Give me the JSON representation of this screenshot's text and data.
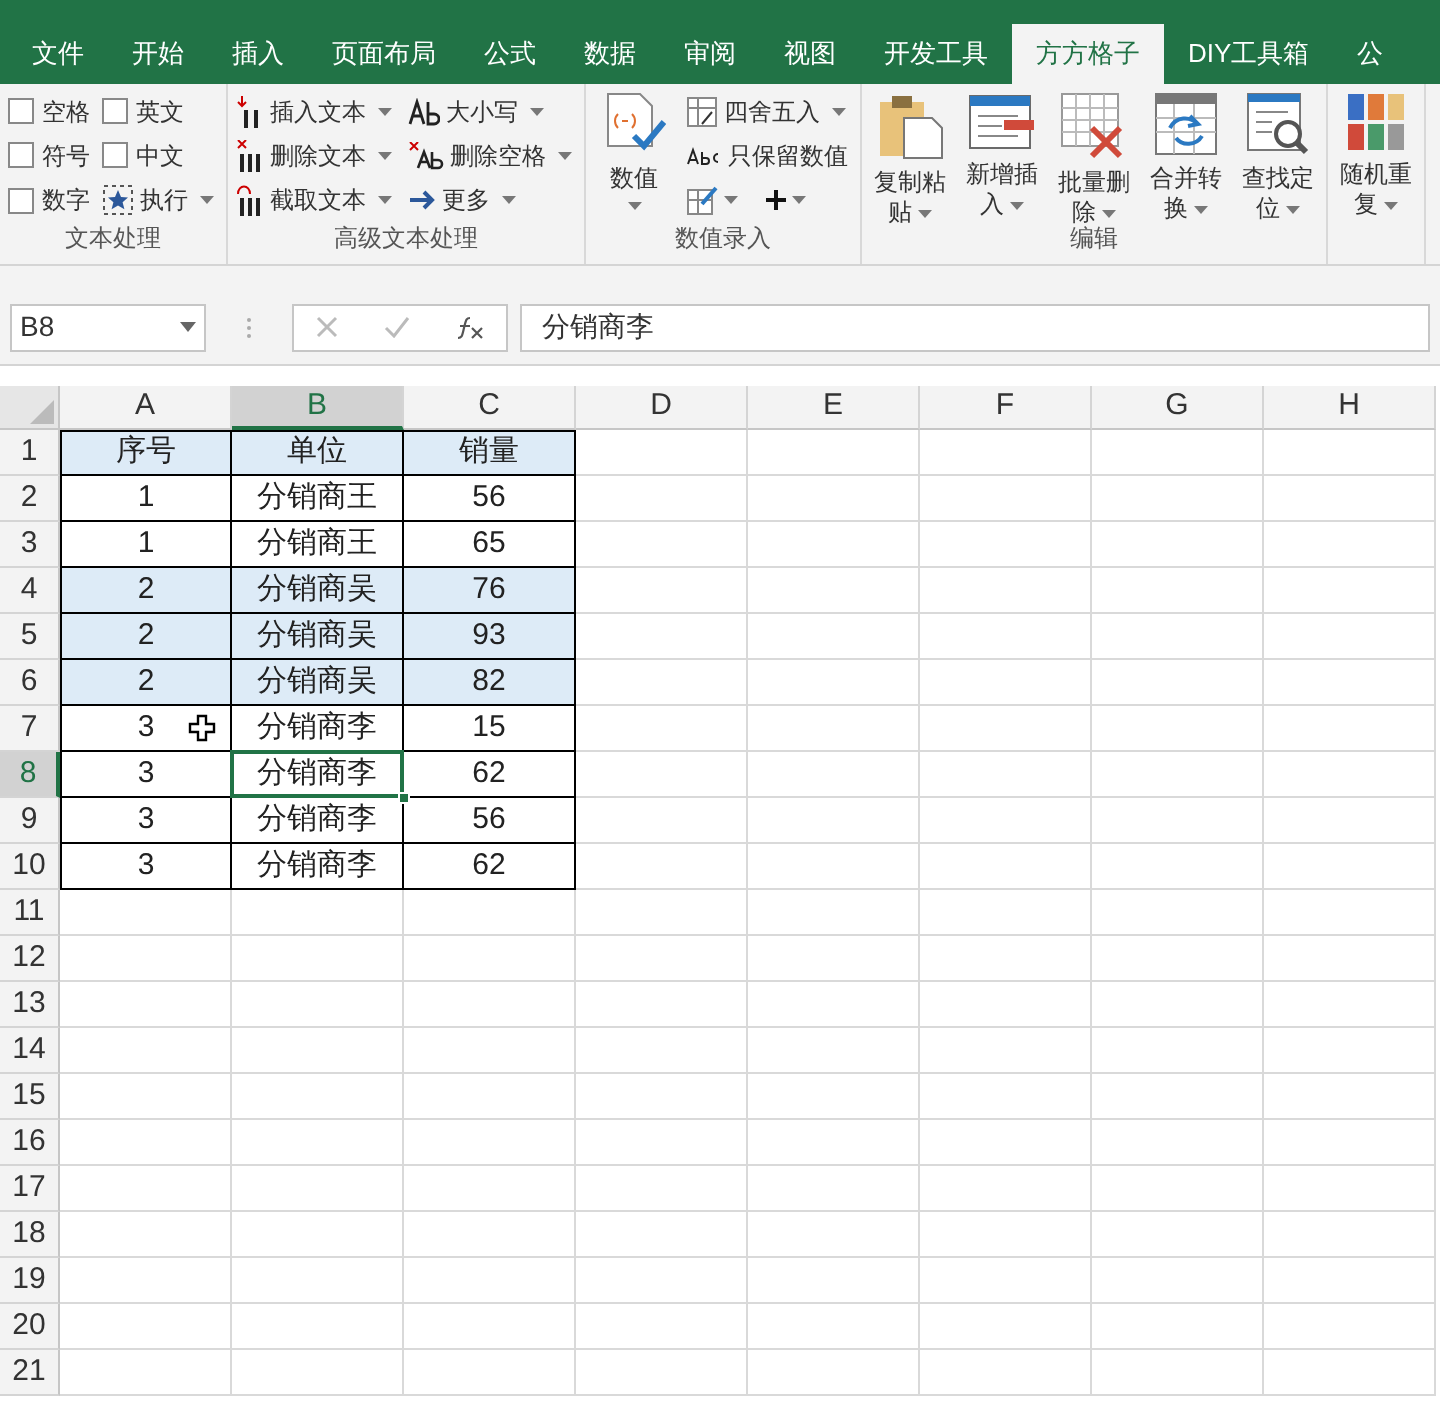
{
  "menu_tabs": [
    {
      "label": "文件",
      "selected": false
    },
    {
      "label": "开始",
      "selected": false
    },
    {
      "label": "插入",
      "selected": false
    },
    {
      "label": "页面布局",
      "selected": false
    },
    {
      "label": "公式",
      "selected": false
    },
    {
      "label": "数据",
      "selected": false
    },
    {
      "label": "审阅",
      "selected": false
    },
    {
      "label": "视图",
      "selected": false
    },
    {
      "label": "开发工具",
      "selected": false
    },
    {
      "label": "方方格子",
      "selected": true
    },
    {
      "label": "DIY工具箱",
      "selected": false
    },
    {
      "label": "公",
      "selected": false
    }
  ],
  "ribbon_groups": [
    {
      "label": "文本处理",
      "columns": [
        [
          {
            "kind": "checkbox",
            "label": "空格",
            "checked": false
          },
          {
            "kind": "checkbox",
            "label": "符号",
            "checked": false
          },
          {
            "kind": "checkbox",
            "label": "数字",
            "checked": false
          }
        ],
        [
          {
            "kind": "checkbox",
            "label": "英文",
            "checked": false
          },
          {
            "kind": "checkbox",
            "label": "中文",
            "checked": false
          },
          {
            "kind": "small",
            "label": "执行",
            "dropdown": true
          }
        ]
      ]
    },
    {
      "label": "高级文本处理",
      "columns": [
        [
          {
            "kind": "small",
            "label": "插入文本",
            "dropdown": true
          },
          {
            "kind": "small",
            "label": "删除文本",
            "dropdown": true
          },
          {
            "kind": "small",
            "label": "截取文本",
            "dropdown": true
          }
        ],
        [
          {
            "kind": "small",
            "label": "大小写",
            "dropdown": true
          },
          {
            "kind": "small",
            "label": "删除空格",
            "dropdown": true
          },
          {
            "kind": "small",
            "label": "更多",
            "dropdown": true
          }
        ]
      ]
    },
    {
      "label": "数值录入",
      "columns": [
        [
          {
            "kind": "large",
            "lines": [
              "数值"
            ],
            "dropdown": true
          }
        ],
        [
          {
            "kind": "small",
            "label": "四舍五入",
            "dropdown": true
          },
          {
            "kind": "small",
            "label": "只保留数值",
            "dropdown": false
          },
          {
            "kind": "pair"
          }
        ]
      ]
    },
    {
      "label": "编辑",
      "columns": [
        [
          {
            "kind": "large",
            "lines": [
              "复制粘",
              "贴"
            ],
            "dropdown": true
          }
        ],
        [
          {
            "kind": "large",
            "lines": [
              "新增插",
              "入"
            ],
            "dropdown": true
          }
        ],
        [
          {
            "kind": "large",
            "lines": [
              "批量删",
              "除"
            ],
            "dropdown": true
          }
        ],
        [
          {
            "kind": "large",
            "lines": [
              "合并转",
              "换"
            ],
            "dropdown": true
          }
        ],
        [
          {
            "kind": "large",
            "lines": [
              "查找定",
              "位"
            ],
            "dropdown": true
          }
        ]
      ]
    },
    {
      "columns": [
        [
          {
            "kind": "large",
            "lines": [
              "随机重",
              "复"
            ],
            "dropdown": true
          }
        ]
      ]
    }
  ],
  "formula_bar": {
    "name_box": "B8",
    "formula": "分销商李"
  },
  "columns": [
    {
      "label": "A",
      "selected": false
    },
    {
      "label": "B",
      "selected": true
    },
    {
      "label": "C",
      "selected": false
    },
    {
      "label": "D",
      "selected": false
    },
    {
      "label": "E",
      "selected": false
    },
    {
      "label": "F",
      "selected": false
    },
    {
      "label": "G",
      "selected": false
    },
    {
      "label": "H",
      "selected": false
    }
  ],
  "rows": [
    {
      "number": "1",
      "selected": false,
      "highlighted": true,
      "cells": [
        "序号",
        "单位",
        "销量"
      ]
    },
    {
      "number": "2",
      "selected": false,
      "highlighted": false,
      "cells": [
        "1",
        "分销商王",
        "56"
      ]
    },
    {
      "number": "3",
      "selected": false,
      "highlighted": false,
      "cells": [
        "1",
        "分销商王",
        "65"
      ]
    },
    {
      "number": "4",
      "selected": false,
      "highlighted": true,
      "cells": [
        "2",
        "分销商吴",
        "76"
      ]
    },
    {
      "number": "5",
      "selected": false,
      "highlighted": true,
      "cells": [
        "2",
        "分销商吴",
        "93"
      ]
    },
    {
      "number": "6",
      "selected": false,
      "highlighted": true,
      "cells": [
        "2",
        "分销商吴",
        "82"
      ]
    },
    {
      "number": "7",
      "selected": false,
      "highlighted": false,
      "cells": [
        "3",
        "分销商李",
        "15"
      ]
    },
    {
      "number": "8",
      "selected": true,
      "highlighted": false,
      "cells": [
        "3",
        "分销商李",
        "62"
      ]
    },
    {
      "number": "9",
      "selected": false,
      "highlighted": false,
      "cells": [
        "3",
        "分销商李",
        "56"
      ]
    },
    {
      "number": "10",
      "selected": false,
      "highlighted": false,
      "cells": [
        "3",
        "分销商李",
        "62"
      ]
    },
    {
      "number": "11",
      "selected": false,
      "cells": []
    },
    {
      "number": "12",
      "selected": false,
      "cells": []
    },
    {
      "number": "13",
      "selected": false,
      "cells": []
    },
    {
      "number": "14",
      "selected": false,
      "cells": []
    },
    {
      "number": "15",
      "selected": false,
      "cells": []
    },
    {
      "number": "16",
      "selected": false,
      "cells": []
    },
    {
      "number": "17",
      "selected": false,
      "cells": []
    },
    {
      "number": "18",
      "selected": false,
      "cells": []
    },
    {
      "number": "19",
      "selected": false,
      "cells": []
    },
    {
      "number": "20",
      "selected": false,
      "cells": []
    },
    {
      "number": "21",
      "selected": false,
      "cells": []
    }
  ]
}
